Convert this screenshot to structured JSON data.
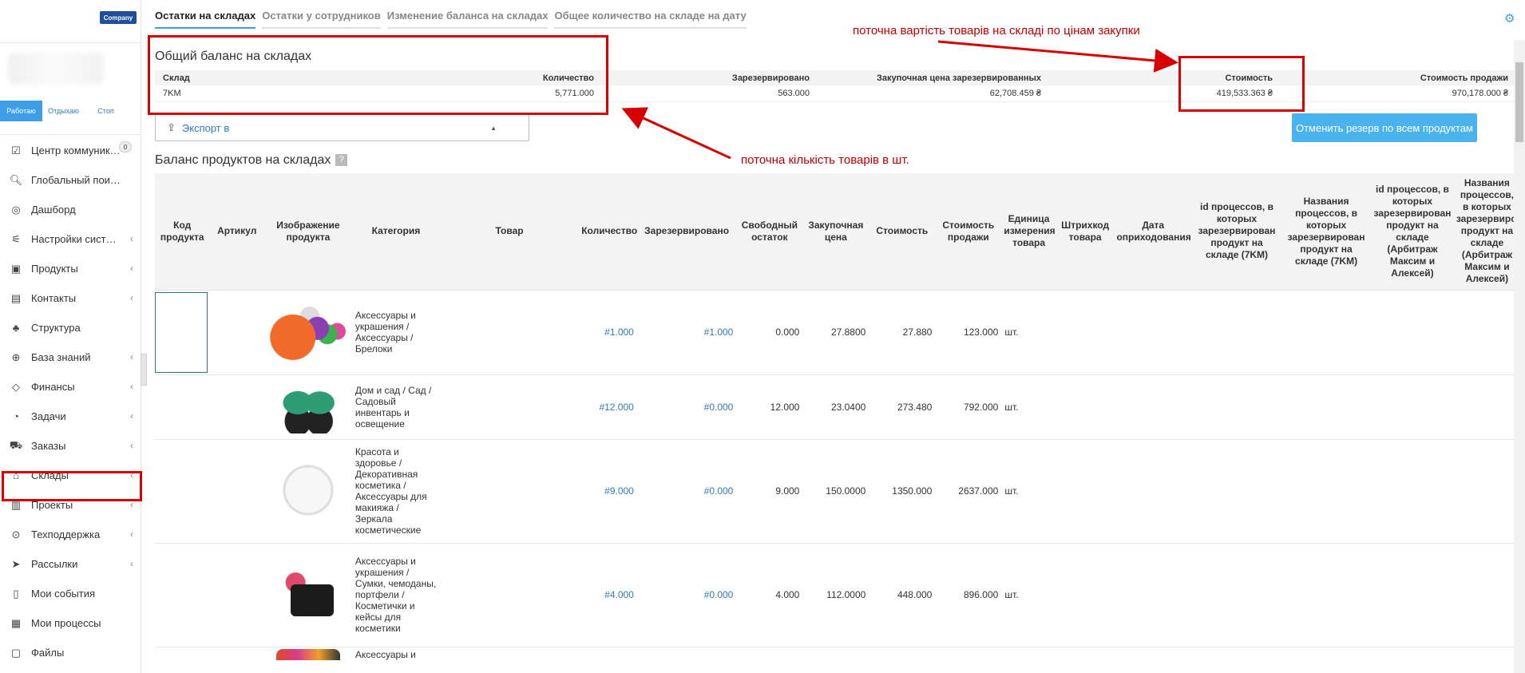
{
  "sidebar": {
    "company": "Company",
    "status_tabs": [
      "Работаю",
      "Отдыхаю",
      "Стоп"
    ],
    "items": [
      {
        "label": "Центр коммуник…",
        "icon": "checkbox-icon",
        "badge": "0"
      },
      {
        "label": "Глобальный пои…",
        "icon": "search-icon"
      },
      {
        "label": "Дашборд",
        "icon": "dashboard-icon"
      },
      {
        "label": "Настройки сист…",
        "icon": "sliders-icon",
        "chevron": true
      },
      {
        "label": "Продукты",
        "icon": "box-icon",
        "chevron": true
      },
      {
        "label": "Контакты",
        "icon": "contacts-icon",
        "chevron": true
      },
      {
        "label": "Структура",
        "icon": "structure-icon"
      },
      {
        "label": "База знаний",
        "icon": "knowledge-icon",
        "chevron": true
      },
      {
        "label": "Финансы",
        "icon": "diamond-icon",
        "chevron": true
      },
      {
        "label": "Задачи",
        "icon": "tasks-icon",
        "chevron": true
      },
      {
        "label": "Заказы",
        "icon": "cart-icon",
        "chevron": true
      },
      {
        "label": "Склады",
        "icon": "warehouse-icon",
        "chevron": true
      },
      {
        "label": "Проекты",
        "icon": "projects-icon",
        "chevron": true
      },
      {
        "label": "Техподдержка",
        "icon": "support-icon",
        "chevron": true
      },
      {
        "label": "Рассылки",
        "icon": "send-icon",
        "chevron": true
      },
      {
        "label": "Мои события",
        "icon": "events-icon"
      },
      {
        "label": "Мои процессы",
        "icon": "processes-icon"
      },
      {
        "label": "Файлы",
        "icon": "files-icon"
      }
    ]
  },
  "tabs": [
    {
      "label": "Остатки на складах",
      "active": true
    },
    {
      "label": "Остатки у сотрудников"
    },
    {
      "label": "Изменение баланса на складах"
    },
    {
      "label": "Общее количество на складе на дату"
    }
  ],
  "summary": {
    "title": "Общий баланс на складах",
    "headers": [
      "Склад",
      "Количество",
      "Зарезервировано",
      "Закупочная цена зарезервированных",
      "Стоимость",
      "Стоимость продажи"
    ],
    "row": [
      "7KM",
      "5,771.000",
      "563.000",
      "62,708.459 ₴",
      "419,533.363 ₴",
      "970,178.000 ₴"
    ]
  },
  "export_label": "Экспорт в",
  "cancel_button": "Отменить резерв по всем продуктам",
  "products_title": "Баланс продуктов на складах",
  "products_help": "?",
  "product_headers": [
    "Код продукта",
    "Артикул",
    "Изображение продукта",
    "Категория",
    "Товар",
    "Количество",
    "Зарезервировано",
    "Свободный остаток",
    "Закупочная цена",
    "Стоимость",
    "Стоимость продажи",
    "Единица измерения товара",
    "Штрихкод товара",
    "Дата оприходования",
    "id процессов, в которых зарезервирован продукт на складе (7KM)",
    "Названия процессов, в которых зарезервирован продукт на складе (7KM)",
    "id процессов, в которых зарезервирован продукт на складе (Арбитраж Максим и Алексей)",
    "Названия процессов, в которых зарезервирован продукт на складе (Арбитраж Максим и Алексей)"
  ],
  "products": [
    {
      "category": "Аксессуары и украшения / Аксессуары / Брелоки",
      "qty": "#1.000",
      "reserved": "#1.000",
      "free": "0.000",
      "price": "27.8800",
      "cost": "27.880",
      "sale": "123.000",
      "unit": "шт.",
      "thumb": "fur"
    },
    {
      "category": "Дом и сад / Сад / Садовый инвентарь и освещение",
      "qty": "#12.000",
      "reserved": "#0.000",
      "free": "12.000",
      "price": "23.0400",
      "cost": "273.480",
      "sale": "792.000",
      "unit": "шт.",
      "thumb": "gloves"
    },
    {
      "category": "Красота и здоровье / Декоративная косметика / Аксессуары для макияжа / Зеркала косметические",
      "qty": "#9.000",
      "reserved": "#0.000",
      "free": "9.000",
      "price": "150.0000",
      "cost": "1350.000",
      "sale": "2637.000",
      "unit": "шт.",
      "thumb": "mirror"
    },
    {
      "category": "Аксессуары и украшения / Сумки, чемоданы, портфели / Косметички и кейсы для косметики",
      "qty": "#4.000",
      "reserved": "#0.000",
      "free": "4.000",
      "price": "112.0000",
      "cost": "448.000",
      "sale": "896.000",
      "unit": "шт.",
      "thumb": "bag"
    },
    {
      "category": "Аксессуары и",
      "qty": "",
      "reserved": "",
      "free": "",
      "price": "",
      "cost": "",
      "sale": "",
      "unit": "",
      "thumb": "pom"
    }
  ],
  "annotations": {
    "cost_note": "поточна вартість товарів на складі по цінам закупки",
    "qty_note": "поточна кількість товарів в шт."
  },
  "colors": {
    "accent": "#3c9ee6",
    "annotation": "#d60000",
    "link": "#337ab7"
  }
}
